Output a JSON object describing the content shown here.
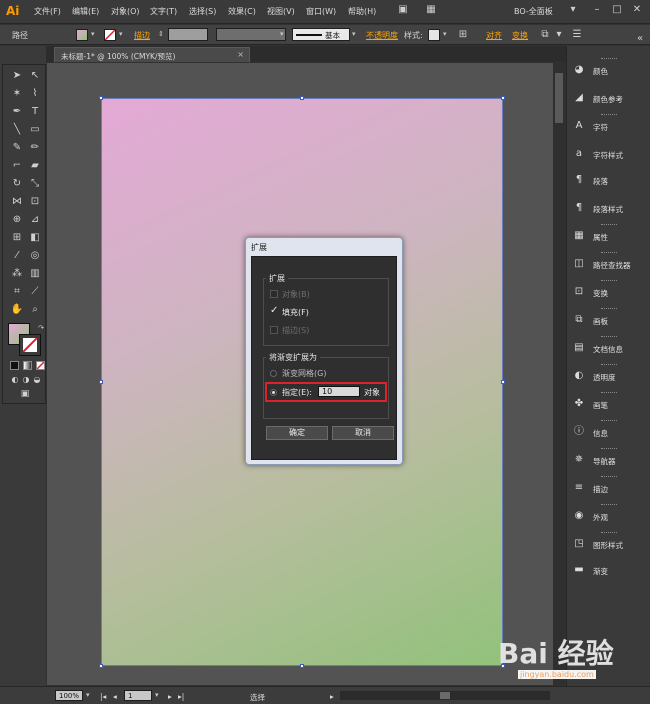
{
  "app": {
    "logo": "Ai",
    "workspace": "BO-全面板"
  },
  "menu": [
    "文件(F)",
    "编辑(E)",
    "对象(O)",
    "文字(T)",
    "选择(S)",
    "效果(C)",
    "视图(V)",
    "窗口(W)",
    "帮助(H)"
  ],
  "control_bar": {
    "object_type": "路径",
    "stroke_label": "描边",
    "stroke_style": "基本",
    "opacity_label": "不透明度",
    "style_label": "样式:",
    "align_label": "对齐",
    "transform_label": "变换"
  },
  "document": {
    "tab_title": "未标题-1* @ 100% (CMYK/预览)"
  },
  "right_panels": [
    "颜色",
    "颜色参考",
    "字符",
    "字符样式",
    "段落",
    "段落样式",
    "属性",
    "路径查找器",
    "变换",
    "画板",
    "文档信息",
    "透明度",
    "画笔",
    "信息",
    "导航器",
    "描边",
    "外观",
    "图形样式",
    "渐变"
  ],
  "status_bar": {
    "zoom": "100%",
    "page": "1",
    "tool": "选择"
  },
  "dialog": {
    "title": "扩展",
    "expand_group": "扩展",
    "options": [
      {
        "label": "对象(B)",
        "checked": false,
        "enabled": false
      },
      {
        "label": "填充(F)",
        "checked": true,
        "enabled": true
      },
      {
        "label": "描边(S)",
        "checked": false,
        "enabled": false
      }
    ],
    "gradient_group": "将渐变扩展为",
    "radio_mesh": "渐变网格(G)",
    "radio_specify": "指定(E):",
    "specify_value": "10",
    "specify_unit": "对象",
    "ok": "确定",
    "cancel": "取消"
  },
  "watermark": {
    "brand": "Bai 经验",
    "site": "jingyan.baidu.com"
  },
  "colors": {
    "accent_orange": "#ff9a00",
    "highlight_red": "#e0202a",
    "gradient_start": "#e4a9d6",
    "gradient_end": "#92c27b"
  }
}
